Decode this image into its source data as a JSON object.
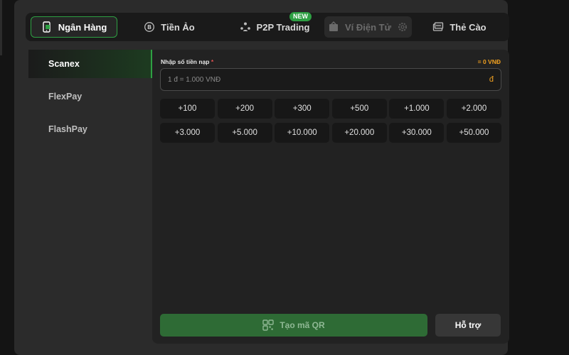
{
  "tabs": [
    {
      "label": "Ngân Hàng",
      "icon": "phone-bank-icon"
    },
    {
      "label": "Tiền Ảo",
      "icon": "crypto-coin-icon"
    },
    {
      "label": "P2P Trading",
      "icon": "p2p-users-icon",
      "badge": "NEW"
    },
    {
      "label": "Ví Điện Tử",
      "icon": "e-wallet-icon"
    },
    {
      "label": "Thẻ Cào",
      "icon": "scratch-card-icon"
    }
  ],
  "sidebar": {
    "items": [
      {
        "label": "Scanex"
      },
      {
        "label": "FlexPay"
      },
      {
        "label": "FlashPay"
      }
    ]
  },
  "form": {
    "label": "Nhập số tiền nạp",
    "required_mark": "*",
    "sum": "= 0 VNĐ",
    "placeholder": "1 đ = 1.000 VNĐ",
    "currency": "đ"
  },
  "amounts": [
    "+100",
    "+200",
    "+300",
    "+500",
    "+1.000",
    "+2.000",
    "+3.000",
    "+5.000",
    "+10.000",
    "+20.000",
    "+30.000",
    "+50.000"
  ],
  "actions": {
    "qr_label": "Tạo mã QR",
    "help_label": "Hỗ trợ"
  },
  "colors": {
    "accent": "#2ea043",
    "warning": "#f0a020"
  }
}
